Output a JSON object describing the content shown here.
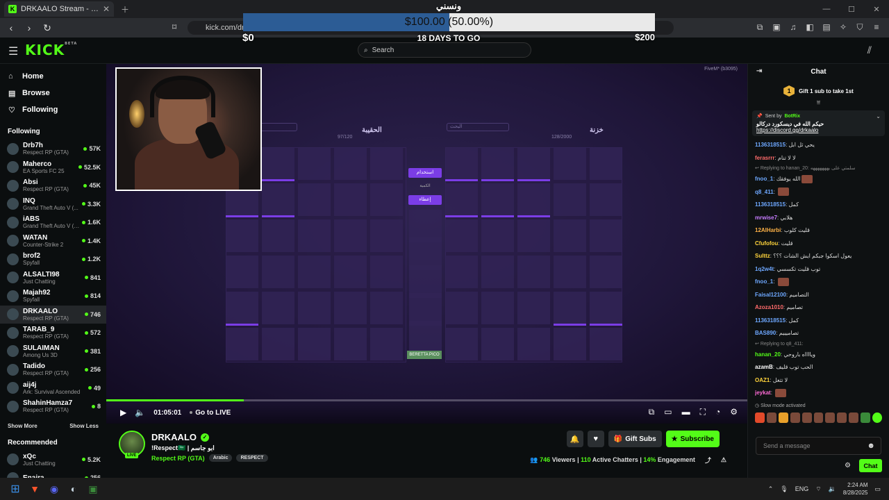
{
  "browser": {
    "tab_title": "DRKAALO Stream - Watch Live o",
    "favicon": "K",
    "url": "kick.com/drkaalo"
  },
  "goal": {
    "title": "ونسني",
    "label": "$100.00 (50.00%)",
    "progress": 0.5,
    "min": "$0",
    "max": "$200",
    "days": "18 DAYS TO GO"
  },
  "header": {
    "logo": "KICK",
    "logo_beta": "BETA",
    "search_placeholder": "Search"
  },
  "sidebar": {
    "nav": [
      {
        "label": "Home"
      },
      {
        "label": "Browse"
      },
      {
        "label": "Following"
      }
    ],
    "following_title": "Following",
    "channels": [
      {
        "name": "Drb7h",
        "game": "Respect RP (GTA)",
        "viewers": "57K"
      },
      {
        "name": "Maherco",
        "game": "EA Sports FC 25",
        "viewers": "52.5K"
      },
      {
        "name": "Absi",
        "game": "Respect RP (GTA)",
        "viewers": "45K"
      },
      {
        "name": "INQ",
        "game": "Grand Theft Auto V (...",
        "viewers": "3.3K"
      },
      {
        "name": "iABS",
        "game": "Grand Theft Auto V (G...",
        "viewers": "1.6K"
      },
      {
        "name": "WATAN",
        "game": "Counter-Strike 2",
        "viewers": "1.4K"
      },
      {
        "name": "brof2",
        "game": "Spyfall",
        "viewers": "1.2K"
      },
      {
        "name": "ALSALTI98",
        "game": "Just Chatting",
        "viewers": "841"
      },
      {
        "name": "Majah92",
        "game": "Spyfall",
        "viewers": "814"
      },
      {
        "name": "DRKAALO",
        "game": "Respect RP (GTA)",
        "viewers": "746",
        "active": true
      },
      {
        "name": "TARAB_9",
        "game": "Respect RP (GTA)",
        "viewers": "572"
      },
      {
        "name": "SULAIMAN",
        "game": "Among Us 3D",
        "viewers": "381"
      },
      {
        "name": "Tadido",
        "game": "Respect RP (GTA)",
        "viewers": "256"
      },
      {
        "name": "aij4j",
        "game": "Ark: Survival Ascended",
        "viewers": "49"
      },
      {
        "name": "ShahinHamza7",
        "game": "Respect RP (GTA)",
        "viewers": "8"
      }
    ],
    "show_more": "Show More",
    "show_less": "Show Less",
    "recommended_title": "Recommended",
    "recommended": [
      {
        "name": "xQc",
        "game": "Just Chatting",
        "viewers": "5.2K"
      },
      {
        "name": "Enaira",
        "game": "",
        "viewers": "256"
      }
    ]
  },
  "video": {
    "watermark": "FiveM* (b3095)",
    "inventory_left_title": "الحقيبة",
    "inventory_left_count": "97/120",
    "inventory_right_title": "خزنة",
    "inventory_right_count": "128/2000",
    "search_ph": "البحث",
    "btn_use": "استخدام",
    "lbl_amount": "الكمية",
    "btn_give": "إعطاء",
    "item_label": "BERETTA PICO",
    "progress": 0.215,
    "time": "01:05:01",
    "go_live": "Go to LIVE"
  },
  "stream": {
    "name": "DRKAALO",
    "live": "LIVE",
    "title": "!Respect🇸🇦 | ابو جاسم",
    "category": "Respect RP (GTA)",
    "tags": [
      "Arabic",
      "RESPECT"
    ],
    "gift_subs": "Gift Subs",
    "subscribe": "Subscribe",
    "viewers": "746",
    "viewers_label": "Viewers",
    "chatters": "110",
    "chatters_label": "Active Chatters",
    "engagement": "14%",
    "engagement_label": "Engagement"
  },
  "chat": {
    "title": "Chat",
    "gift_badge": "1",
    "gift_text": "Gift 1 sub to take 1st",
    "pin_sent_by": "Sent by",
    "pin_bot": "BotRix",
    "pin_msg": "حيكم الله في ديسكورد دركالو",
    "pin_link": "https://discord.gg/drkaalo",
    "messages": [
      {
        "user": "1136318515",
        "color": "#6ea8ff",
        "text": "يحي ثل ابل"
      },
      {
        "user": "ferasrrr",
        "color": "#ff6b6b",
        "text": "لا لا تنام"
      },
      {
        "reply": "Replying to hanan_20: سلمتي على يهههههههه"
      },
      {
        "user": "fnoo_1",
        "color": "#6ea8ff",
        "text": "الله يوفقك",
        "emote": true
      },
      {
        "user": "q8_411",
        "color": "#6ea8ff",
        "text": "",
        "emote": true
      },
      {
        "user": "1136318515",
        "color": "#6ea8ff",
        "text": "كمل"
      },
      {
        "user": "mrwise7",
        "color": "#c77dff",
        "text": "هلابي"
      },
      {
        "user": "12AlHarbi",
        "color": "#ffb347",
        "text": "قليت كلوب"
      },
      {
        "user": "Cfufofou",
        "color": "#ffd43b",
        "text": "قليت"
      },
      {
        "user": "Sulttz",
        "color": "#ffd43b",
        "text": "يعول اسكوا جبكم ايش الشات ؟؟؟"
      },
      {
        "user": "1q2w4t",
        "color": "#6ea8ff",
        "text": "توب قليت تكسسي"
      },
      {
        "user": "fnoo_1",
        "color": "#6ea8ff",
        "text": "",
        "emote": true
      },
      {
        "user": "Faisal12100",
        "color": "#6ea8ff",
        "text": "التصاميم"
      },
      {
        "user": "Azoza1010",
        "color": "#ff6b6b",
        "text": "تصاميم"
      },
      {
        "user": "1136318515",
        "color": "#6ea8ff",
        "text": "كمل"
      },
      {
        "user": "BAS890",
        "color": "#6ea8ff",
        "text": "تصاميييم"
      },
      {
        "reply": "Replying to q8_411:"
      },
      {
        "user": "hanan_20",
        "color": "#53fc18",
        "text": "ويااااه باروحي"
      },
      {
        "user": "azamB",
        "color": "#fff",
        "text": "الحب توب قليف"
      },
      {
        "user": "OAZ1",
        "color": "#ffd43b",
        "text": "لا تتغل"
      },
      {
        "user": "jeykat",
        "color": "#ff6bd6",
        "text": "",
        "emote": true
      }
    ],
    "slow_mode": "Slow mode activated",
    "input_placeholder": "Send a message",
    "send": "Chat"
  },
  "taskbar": {
    "lang": "ENG",
    "time": "2:24 AM",
    "date": "8/28/2025"
  }
}
